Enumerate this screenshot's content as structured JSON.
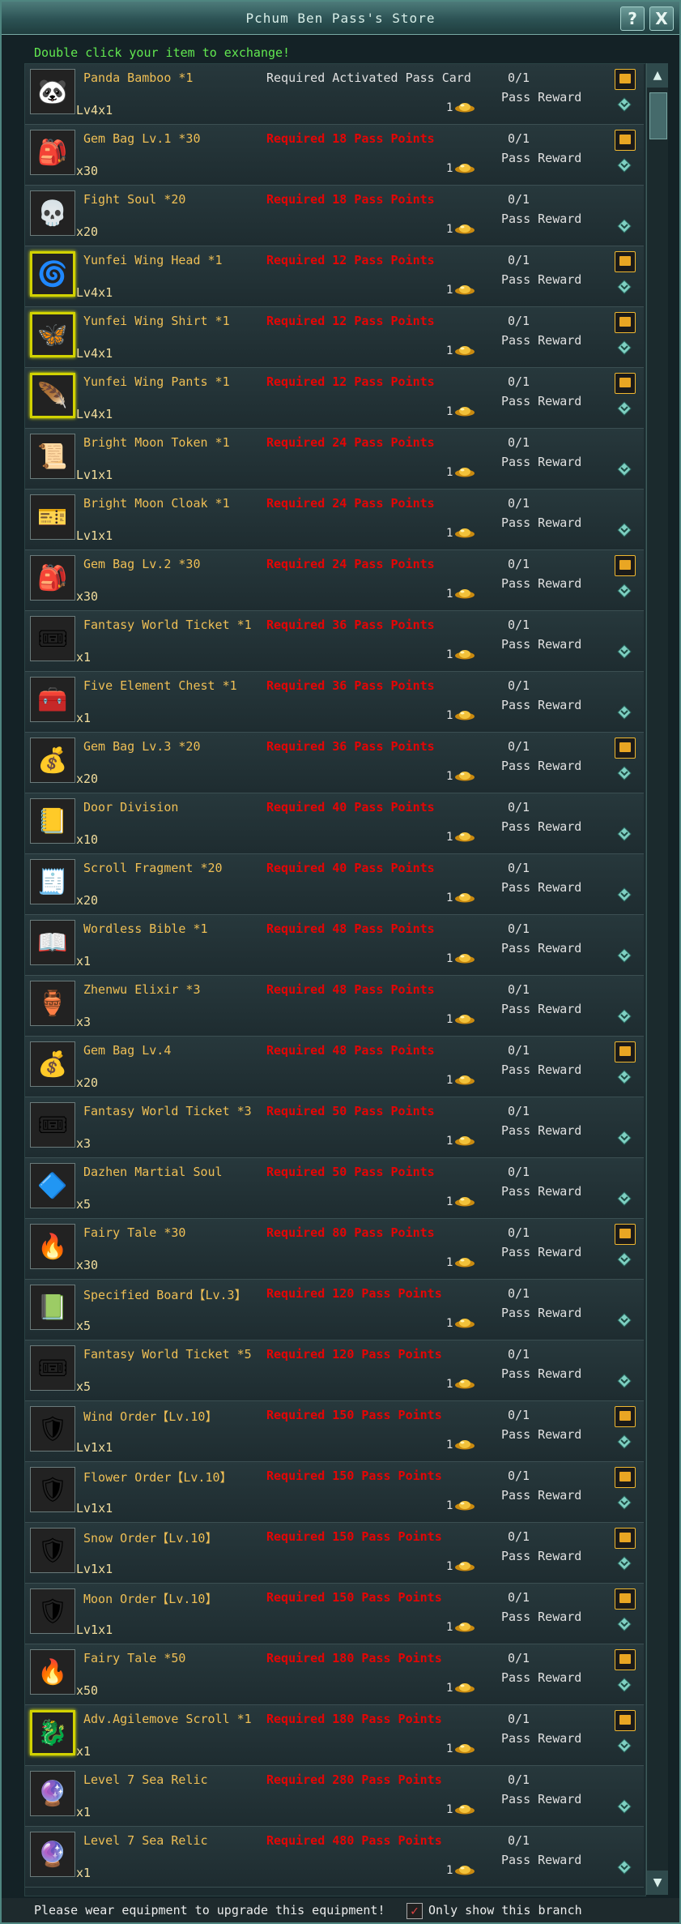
{
  "window": {
    "title": "Pchum Ben Pass's Store",
    "help_label": "?",
    "close_label": "X"
  },
  "hint": "Double click your item to exchange!",
  "cost_value": "1",
  "progress_text": "0/1",
  "reward_text": "Pass Reward",
  "items": [
    {
      "name": "Panda Bamboo *1",
      "qty": "Lv4x1",
      "req": "Required Activated Pass Card",
      "icon": "panda-icon",
      "emoji": "🐼",
      "gold": false,
      "lock": true
    },
    {
      "name": "Gem Bag Lv.1 *30",
      "qty": "x30",
      "req": "Required 18 Pass Points",
      "icon": "gem-bag-icon",
      "emoji": "🎒",
      "gold": false,
      "lock": true
    },
    {
      "name": "Fight Soul *20",
      "qty": "x20",
      "req": "Required 18 Pass Points",
      "icon": "fight-soul-icon",
      "emoji": "💀",
      "gold": false,
      "lock": false
    },
    {
      "name": "Yunfei Wing Head *1",
      "qty": "Lv4x1",
      "req": "Required 12 Pass Points",
      "icon": "wing-head-icon",
      "emoji": "🌀",
      "gold": true,
      "lock": true
    },
    {
      "name": "Yunfei Wing Shirt *1",
      "qty": "Lv4x1",
      "req": "Required 12 Pass Points",
      "icon": "wing-shirt-icon",
      "emoji": "🦋",
      "gold": true,
      "lock": true
    },
    {
      "name": "Yunfei Wing Pants *1",
      "qty": "Lv4x1",
      "req": "Required 12 Pass Points",
      "icon": "wing-pants-icon",
      "emoji": "🪶",
      "gold": true,
      "lock": true
    },
    {
      "name": "Bright Moon Token *1",
      "qty": "Lv1x1",
      "req": "Required 24 Pass Points",
      "icon": "moon-token-icon",
      "emoji": "📜",
      "gold": false,
      "lock": false
    },
    {
      "name": "Bright Moon Cloak *1",
      "qty": "Lv1x1",
      "req": "Required 24 Pass Points",
      "icon": "moon-cloak-icon",
      "emoji": "🎫",
      "gold": false,
      "lock": false
    },
    {
      "name": "Gem Bag Lv.2 *30",
      "qty": "x30",
      "req": "Required 24 Pass Points",
      "icon": "gem-bag-icon",
      "emoji": "🎒",
      "gold": false,
      "lock": true
    },
    {
      "name": "Fantasy World Ticket *1",
      "qty": "x1",
      "req": "Required 36 Pass Points",
      "icon": "ticket-icon",
      "emoji": "🎟",
      "gold": false,
      "lock": false
    },
    {
      "name": "Five Element Chest *1",
      "qty": "x1",
      "req": "Required 36 Pass Points",
      "icon": "chest-icon",
      "emoji": "🧰",
      "gold": false,
      "lock": false
    },
    {
      "name": "Gem Bag Lv.3 *20",
      "qty": "x20",
      "req": "Required 36 Pass Points",
      "icon": "gem-bag-icon",
      "emoji": "💰",
      "gold": false,
      "lock": true
    },
    {
      "name": "Door          Division",
      "qty": "x10",
      "req": "Required 40 Pass Points",
      "icon": "door-division-icon",
      "emoji": "📒",
      "gold": false,
      "lock": false
    },
    {
      "name": "Scroll Fragment *20",
      "qty": "x20",
      "req": "Required 40 Pass Points",
      "icon": "scroll-fragment-icon",
      "emoji": "🧾",
      "gold": false,
      "lock": false
    },
    {
      "name": "Wordless Bible *1",
      "qty": "x1",
      "req": "Required 48 Pass Points",
      "icon": "bible-icon",
      "emoji": "📖",
      "gold": false,
      "lock": false
    },
    {
      "name": "Zhenwu Elixir *3",
      "qty": "x3",
      "req": "Required 48 Pass Points",
      "icon": "elixir-icon",
      "emoji": "🏺",
      "gold": false,
      "lock": false
    },
    {
      "name": "Gem Bag Lv.4",
      "qty": "x20",
      "req": "Required 48 Pass Points",
      "icon": "gem-bag-icon",
      "emoji": "💰",
      "gold": false,
      "lock": true
    },
    {
      "name": "Fantasy World Ticket *3",
      "qty": "x3",
      "req": "Required 50 Pass Points",
      "icon": "ticket-icon",
      "emoji": "🎟",
      "gold": false,
      "lock": false
    },
    {
      "name": "Dazhen   Martial   Soul",
      "qty": "x5",
      "req": "Required 50 Pass Points",
      "icon": "martial-soul-icon",
      "emoji": "🔷",
      "gold": false,
      "lock": false
    },
    {
      "name": "Fairy Tale *30",
      "qty": "x30",
      "req": "Required 80 Pass Points",
      "icon": "fairy-tale-icon",
      "emoji": "🔥",
      "gold": false,
      "lock": true
    },
    {
      "name": "Specified Board【Lv.3】",
      "qty": "x5",
      "req": "Required 120 Pass Points",
      "icon": "board-icon",
      "emoji": "📗",
      "gold": false,
      "lock": false
    },
    {
      "name": "Fantasy World Ticket *5",
      "qty": "x5",
      "req": "Required 120 Pass Points",
      "icon": "ticket-icon",
      "emoji": "🎟",
      "gold": false,
      "lock": false
    },
    {
      "name": "Wind Order【Lv.10】",
      "qty": "Lv1x1",
      "req": "Required 150 Pass Points",
      "icon": "wind-order-icon",
      "emoji": "🛡",
      "gold": false,
      "lock": true
    },
    {
      "name": "Flower Order【Lv.10】",
      "qty": "Lv1x1",
      "req": "Required 150 Pass Points",
      "icon": "flower-order-icon",
      "emoji": "🛡",
      "gold": false,
      "lock": true
    },
    {
      "name": "Snow Order【Lv.10】",
      "qty": "Lv1x1",
      "req": "Required 150 Pass Points",
      "icon": "snow-order-icon",
      "emoji": "🛡",
      "gold": false,
      "lock": true
    },
    {
      "name": "Moon Order【Lv.10】",
      "qty": "Lv1x1",
      "req": "Required 150 Pass Points",
      "icon": "moon-order-icon",
      "emoji": "🛡",
      "gold": false,
      "lock": true
    },
    {
      "name": "Fairy Tale *50",
      "qty": "x50",
      "req": "Required 180 Pass Points",
      "icon": "fairy-tale-icon",
      "emoji": "🔥",
      "gold": false,
      "lock": true
    },
    {
      "name": "Adv.Agilemove Scroll *1",
      "qty": "x1",
      "req": "Required 180 Pass Points",
      "icon": "agilemove-scroll-icon",
      "emoji": "🐉",
      "gold": true,
      "lock": true
    },
    {
      "name": "Level   7   Sea   Relic",
      "qty": "x1",
      "req": "Required 280 Pass Points",
      "icon": "sea-relic-icon",
      "emoji": "🔮",
      "gold": false,
      "lock": false
    },
    {
      "name": "Level   7   Sea   Relic",
      "qty": "x1",
      "req": "Required 480 Pass Points",
      "icon": "sea-relic-icon",
      "emoji": "🔮",
      "gold": false,
      "lock": false
    }
  ],
  "footer": {
    "note": "Please wear equipment to upgrade this equipment!",
    "checkbox_label": "Only show this branch",
    "checkbox_mark": "✓"
  },
  "colors": {
    "accent_gold": "#efbf55",
    "required_red": "#e50505",
    "hint_green": "#62e850"
  }
}
